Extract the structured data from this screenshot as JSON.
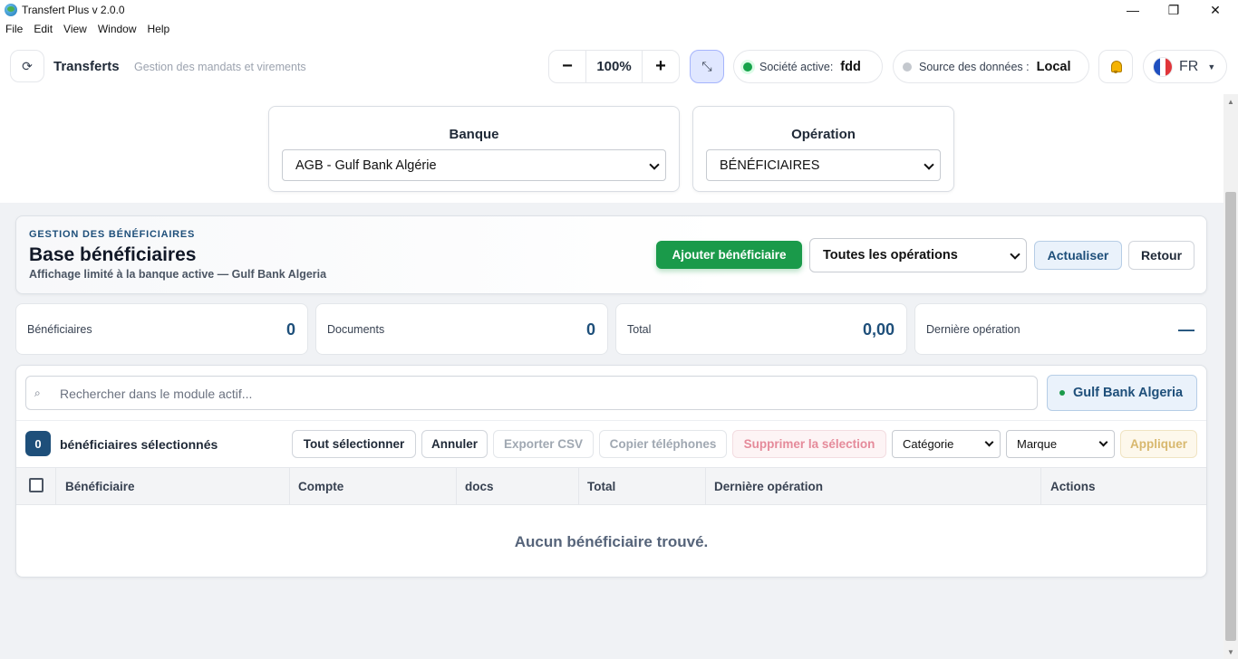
{
  "window": {
    "title": "Transfert Plus v 2.0.0",
    "minimize": "—",
    "restore": "❐",
    "close": "✕"
  },
  "menu": [
    "File",
    "Edit",
    "View",
    "Window",
    "Help"
  ],
  "header": {
    "refresh_icon": "⟳",
    "title": "Transferts",
    "subtitle": "Gestion des mandats et virements",
    "zoom_out": "−",
    "zoom_value": "100%",
    "zoom_in": "+",
    "compact_icon": "⤡",
    "company_label": "Société active:",
    "company_value": "fdd",
    "company_status_color": "#16a34a",
    "source_label": "Source des données :",
    "source_value": "Local",
    "source_status_color": "#c4c8ce",
    "language": "FR",
    "language_caret": "▼"
  },
  "selectors": {
    "bank_label": "Banque",
    "bank_value": "AGB - Gulf Bank Algérie",
    "operation_label": "Opération",
    "operation_value": "BÉNÉFICIAIRES"
  },
  "module": {
    "kicker": "GESTION DES BÉNÉFICIAIRES",
    "title": "Base bénéficiaires",
    "subtitle": "Affichage limité à la banque active — Gulf Bank Algeria",
    "add_button": "Ajouter bénéficiaire",
    "filter_value": "Toutes les opérations",
    "refresh_button": "Actualiser",
    "back_button": "Retour"
  },
  "stats": [
    {
      "label": "Bénéficiaires",
      "value": "0"
    },
    {
      "label": "Documents",
      "value": "0"
    },
    {
      "label": "Total",
      "value": "0,00"
    },
    {
      "label": "Dernière opération",
      "value": "—"
    }
  ],
  "list": {
    "search_icon": "⌕",
    "search_placeholder": "Rechercher dans le module actif...",
    "bank_chip": "Gulf Bank Algeria",
    "selected_count": "0",
    "selected_label": "bénéficiaires sélectionnés",
    "select_all": "Tout sélectionner",
    "cancel": "Annuler",
    "export_csv": "Exporter CSV",
    "copy_phones": "Copier téléphones",
    "delete_selection": "Supprimer la sélection",
    "category": "Catégorie",
    "brand": "Marque",
    "apply": "Appliquer",
    "columns": [
      "Bénéficiaire",
      "Compte",
      "docs",
      "Total",
      "Dernière opération",
      "Actions"
    ],
    "empty_message": "Aucun bénéficiaire trouvé."
  },
  "colors": {
    "primary": "#1e4f7a",
    "success": "#1a9a4a",
    "background": "#f0f2f5"
  }
}
